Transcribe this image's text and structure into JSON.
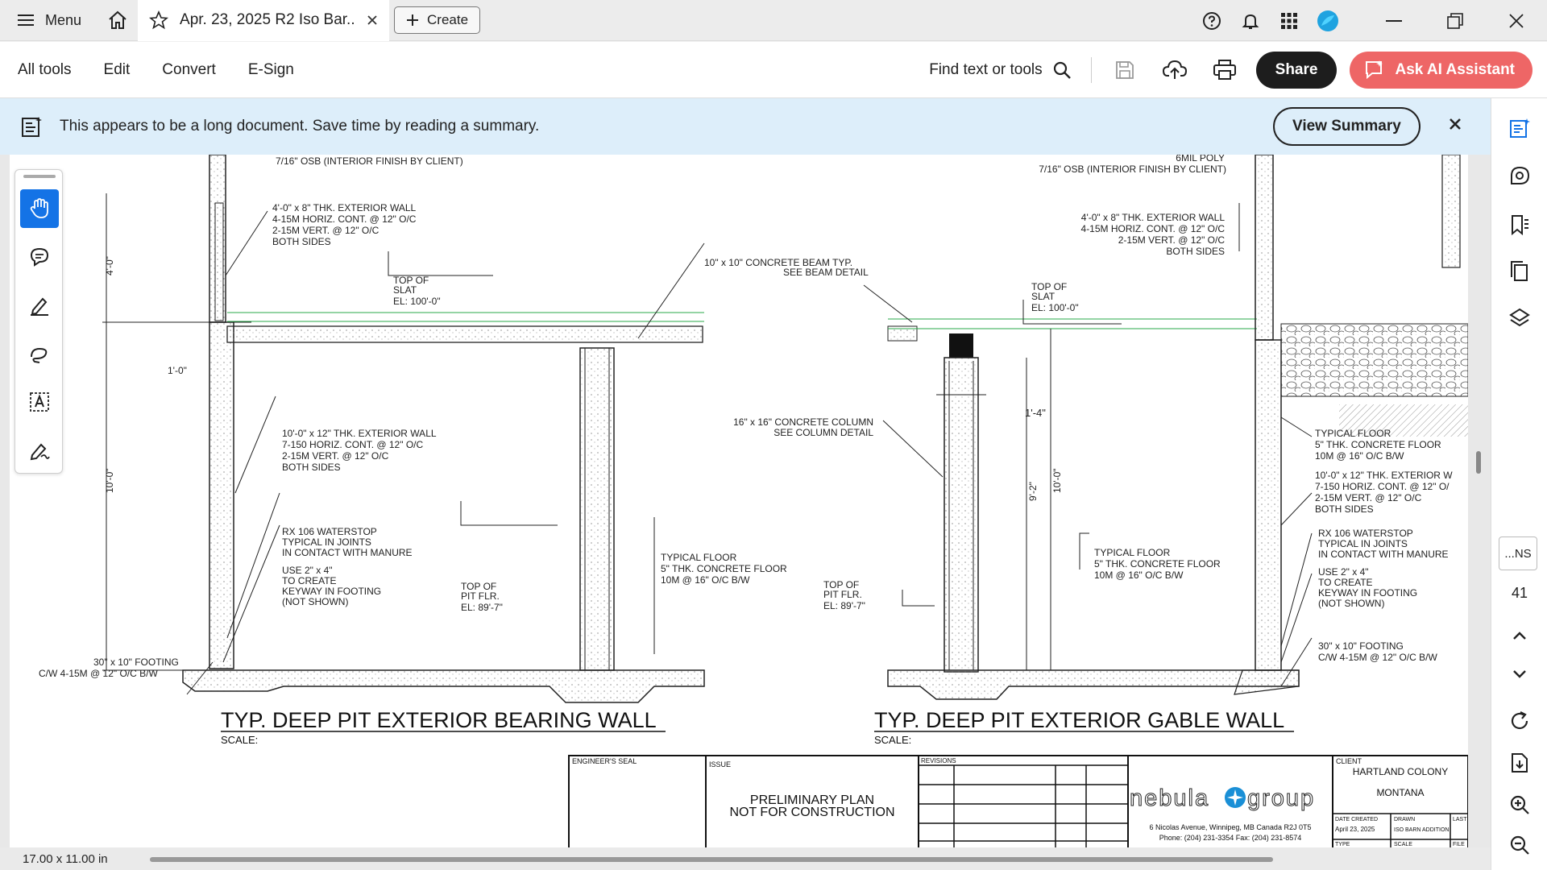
{
  "titlebar": {
    "menu_label": "Menu",
    "tab_title": "Apr. 23, 2025 R2 Iso Bar...",
    "create_label": "Create"
  },
  "toolbar": {
    "items": [
      "All tools",
      "Edit",
      "Convert",
      "E-Sign"
    ],
    "find_label": "Find text or tools",
    "share_label": "Share",
    "ai_label": "Ask AI Assistant"
  },
  "banner": {
    "text": "This appears to be a long document. Save time by reading a summary.",
    "button": "View Summary"
  },
  "sidebar": {
    "ns_label": "...NS",
    "page_number": "41"
  },
  "status": {
    "dimensions": "17.00 x 11.00 in"
  },
  "drawing": {
    "left_title": "TYP. DEEP PIT EXTERIOR BEARING WALL",
    "right_title": "TYP. DEEP PIT EXTERIOR GABLE WALL",
    "scale_label": "SCALE:",
    "left_notes": {
      "osb": "7/16\" OSB (INTERIOR FINISH BY CLIENT)",
      "wall_top": [
        "4'-0\" x 8\" THK. EXTERIOR WALL",
        "4-15M HORIZ. CONT. @ 12\" O/C",
        "2-15M VERT. @ 12\" O/C",
        "BOTH SIDES"
      ],
      "top_of_slat": [
        "TOP OF",
        "SLAT",
        "EL: 100'-0\""
      ],
      "beam": [
        "10\" x 10\" CONCRETE BEAM TYP.",
        "SEE BEAM DETAIL"
      ],
      "dim_1_0": "1'-0\"",
      "dim_4_0": "4'-0\"",
      "dim_10_0": "10'-0\"",
      "wall_low": [
        "10'-0\" x 12\" THK. EXTERIOR WALL",
        "7-150 HORIZ. CONT. @ 12\" O/C",
        "2-15M VERT. @ 12\" O/C",
        "BOTH SIDES"
      ],
      "waterstop": [
        "RX 106 WATERSTOP",
        "TYPICAL IN JOINTS",
        "IN CONTACT WITH MANURE"
      ],
      "keyway": [
        "USE 2\" x 4\"",
        "TO CREATE",
        "KEYWAY IN FOOTING",
        "(NOT SHOWN)"
      ],
      "pit_flr": [
        "TOP OF",
        "PIT FLR.",
        "EL: 89'-7\""
      ],
      "typ_floor": [
        "TYPICAL FLOOR",
        "5\" THK. CONCRETE FLOOR",
        "10M @ 16\" O/C B/W"
      ],
      "footing": [
        "30\" x 10\" FOOTING",
        "C/W 4-15M @ 12\" O/C B/W"
      ]
    },
    "right_notes": {
      "poly": "6MIL POLY",
      "osb": "7/16\" OSB (INTERIOR FINISH BY CLIENT)",
      "wall_top": [
        "4'-0\" x 8\" THK. EXTERIOR WALL",
        "4-15M HORIZ. CONT. @ 12\" O/C",
        "2-15M VERT. @ 12\" O/C",
        "BOTH SIDES"
      ],
      "top_of_slat": [
        "TOP OF",
        "SLAT",
        "EL: 100'-0\""
      ],
      "column": [
        "16\" x 16\" CONCRETE COLUMN",
        "SEE COLUMN DETAIL"
      ],
      "dim_1_4": "1'-4\"",
      "dim_9_2": "9'-2\"",
      "dim_10_0": "10'-0\"",
      "typ_floor_mid": [
        "TYPICAL FLOOR",
        "5\" THK. CONCRETE FLOOR",
        "10M @ 16\" O/C B/W"
      ],
      "pit_flr": [
        "TOP OF",
        "PIT FLR.",
        "EL: 89'-7\""
      ],
      "typ_floor_right": [
        "TYPICAL FLOOR",
        "5\" THK. CONCRETE FLOOR",
        "10M @ 16\" O/C B/W"
      ],
      "wall_low": [
        "10'-0\" x 12\" THK. EXTERIOR W",
        "7-150 HORIZ. CONT. @ 12\" O/",
        "2-15M VERT. @ 12\" O/C",
        "BOTH SIDES"
      ],
      "waterstop": [
        "RX 106 WATERSTOP",
        "TYPICAL IN JOINTS",
        "IN CONTACT WITH MANURE"
      ],
      "keyway": [
        "USE 2\" x 4\"",
        "TO CREATE",
        "KEYWAY IN FOOTING",
        "(NOT SHOWN)"
      ],
      "footing": [
        "30\" x 10\" FOOTING",
        "C/W 4-15M @ 12\" O/C B/W"
      ]
    },
    "titleblock": {
      "engineers_seal": "ENGINEER'S SEAL",
      "issue": "ISSUE",
      "issue_text": [
        "PRELIMINARY PLAN",
        "NOT FOR CONSTRUCTION"
      ],
      "revisions": "REVISIONS",
      "logo_left": "nebula",
      "logo_right": "group",
      "address": "6 Nicolas Avenue, Winnipeg, MB Canada R2J 0T5",
      "phone": "Phone: (204) 231-3354     Fax: (204) 231-8574",
      "client_label": "CLIENT",
      "client_name": "HARTLAND COLONY",
      "client_state": "MONTANA",
      "date_created_label": "DATE CREATED",
      "date_created": "April 23, 2025",
      "drawn_label": "DRAWN",
      "drawn": "ISO BARN ADDITION",
      "last_label": "LAST",
      "scale_label": "SCALE",
      "type_label": "TYPE",
      "file_label": "FILE"
    }
  }
}
